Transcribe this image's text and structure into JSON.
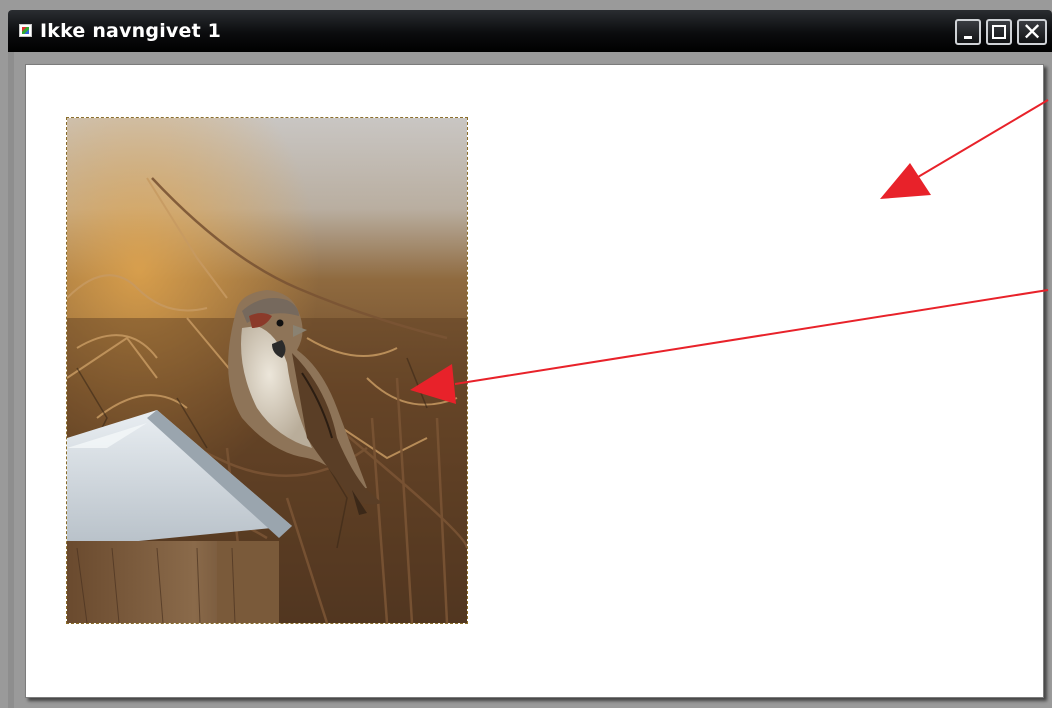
{
  "window": {
    "title": "Ikke navngivet 1",
    "icons": {
      "app": "document-icon",
      "minimize": "minimize-icon",
      "maximize": "maximize-icon",
      "close": "close-icon"
    },
    "close_glyph": "✕"
  },
  "canvas": {
    "image_subject": "sparrow on branches with fence post",
    "selection_marquee": "dashed"
  },
  "annotations": {
    "arrow_color": "#e8222a",
    "arrows": [
      "arrow-to-canvas-background",
      "arrow-to-photo-edge"
    ]
  },
  "colors": {
    "titlebar": "#000000",
    "frame": "#9a9a9a",
    "canvas": "#ffffff"
  }
}
